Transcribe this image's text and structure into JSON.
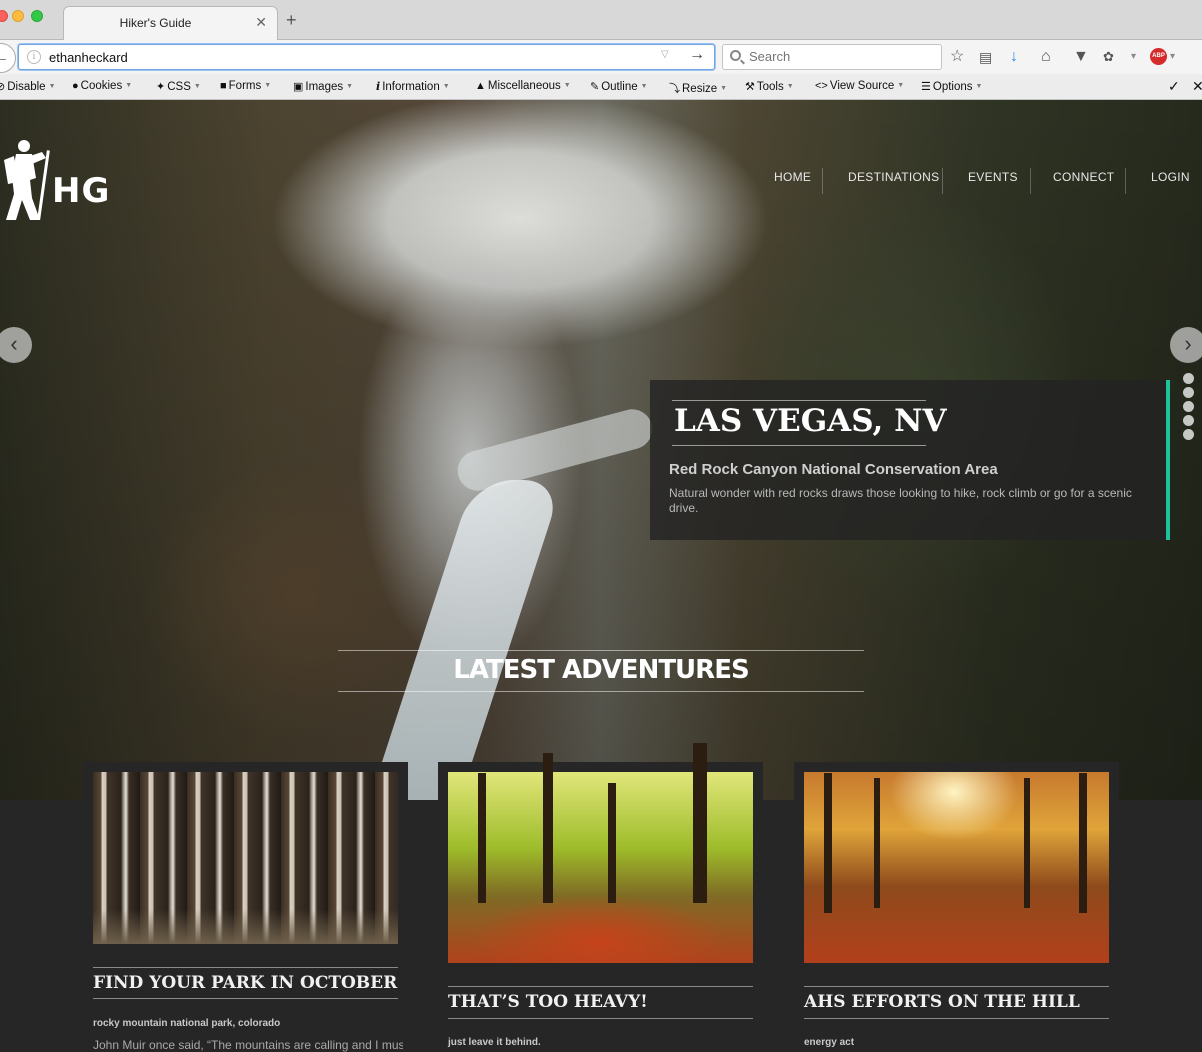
{
  "browser": {
    "tab_title": "Hiker's Guide",
    "tab_close": "✕",
    "new_tab": "+",
    "url": "ethanheckard",
    "search_placeholder": "Search"
  },
  "devtools_bar": {
    "items": [
      "Disable",
      "Cookies",
      "CSS",
      "Forms",
      "Images",
      "Information",
      "Miscellaneous",
      "Outline",
      "Resize",
      "Tools",
      "View Source",
      "Options"
    ]
  },
  "site": {
    "logo_text": "HG",
    "nav": [
      "HOME",
      "DESTINATIONS",
      "EVENTS",
      "CONNECT",
      "LOGIN"
    ]
  },
  "slider": {
    "city": "LAS VEGAS, NV",
    "place": "Red Rock Canyon National Conservation Area",
    "description": "Natural wonder with red rocks draws those looking to hike, rock climb or go for a scenic drive.",
    "accent_color": "#1fc29a",
    "dot_count": 5
  },
  "latest": {
    "heading": "LATEST ADVENTURES"
  },
  "cards": [
    {
      "title": "FIND YOUR PARK IN OCTOBER",
      "tag": "rocky mountain national park, colorado",
      "text": "John Muir once said, “The mountains are calling and I must"
    },
    {
      "title": "THAT’S TOO HEAVY!",
      "tag": "just leave it behind.",
      "text": ""
    },
    {
      "title": "AHS EFFORTS ON THE HILL",
      "tag": "energy act",
      "text": ""
    }
  ]
}
